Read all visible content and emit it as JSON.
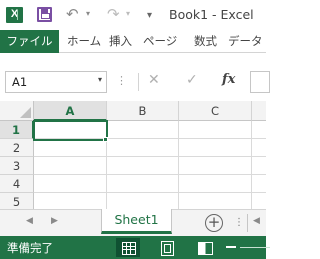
{
  "titlebar": {
    "app_icon_letter": "X",
    "quick_access": {
      "undo_glyph": "↶",
      "redo_glyph": "↷",
      "dropdown_glyph": "▾",
      "customize_glyph": "▾"
    },
    "window_title": "Book1 - Excel"
  },
  "ribbon": {
    "tabs": [
      {
        "label": "ファイル"
      },
      {
        "label": "ホーム"
      },
      {
        "label": "挿入"
      },
      {
        "label": "ページ"
      },
      {
        "label": "数式"
      },
      {
        "label": "データ"
      }
    ]
  },
  "formula_bar": {
    "name_box_value": "A1",
    "name_box_dropdown": "▾",
    "grip": "⋮",
    "cancel_glyph": "✕",
    "enter_glyph": "✓",
    "fx_label": "fx",
    "formula_value": ""
  },
  "grid": {
    "columns": [
      "A",
      "B",
      "C"
    ],
    "rows": [
      "1",
      "2",
      "3",
      "4",
      "5"
    ],
    "selected_cell": "A1"
  },
  "sheet_tabs": {
    "prev_glyph": "◀",
    "next_glyph": "▶",
    "active_sheet": "Sheet1",
    "add_glyph": "+",
    "more_glyph": "⋮",
    "scroll_glyph": "◀"
  },
  "status_bar": {
    "status_text": "準備完了",
    "brand_color": "#217346"
  }
}
